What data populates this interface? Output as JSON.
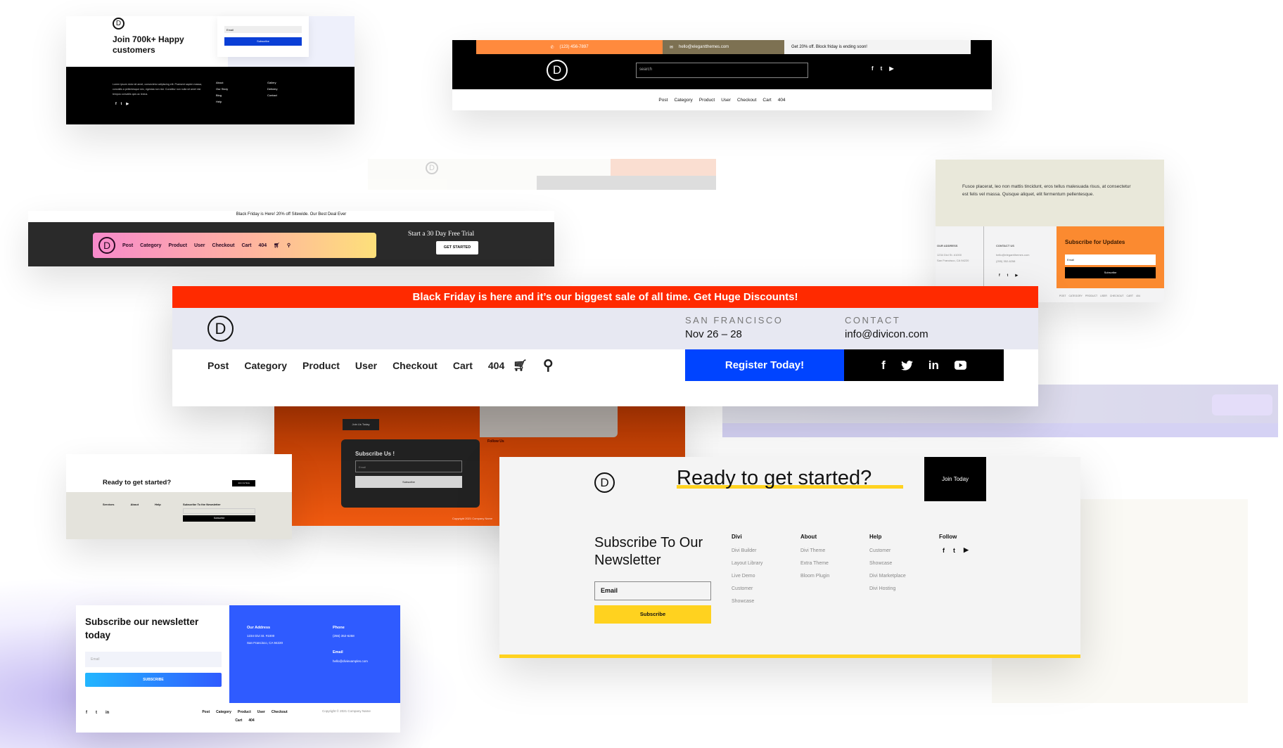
{
  "card_join": {
    "title": "Join 700k+ Happy customers",
    "email_placeholder": "Email",
    "subscribe": "Subscribe",
    "lorem": "Lorem ipsum dolor sit amet, consectetur adipiscing elit. Praesent sapien massa, convallis a pellentesque nec, egestas non nisi. Curabitur non nulla sit amet nisl tempus convallis quis ac lectus.",
    "col1": [
      "About",
      "Our Story",
      "Blog",
      "Help"
    ],
    "col2": [
      "Gallery",
      "Delivery",
      "Contact"
    ]
  },
  "card_search": {
    "phone": "(123) 456-7897",
    "email": "hello@elegantthemes.com",
    "promo": "Get 20% off. Block friday is ending soon!",
    "search_placeholder": "search",
    "nav": [
      "Post",
      "Category",
      "Product",
      "User",
      "Checkout",
      "Cart",
      "404"
    ]
  },
  "card_gradient": {
    "banner": "Black Friday is Here! 20% off Sitewide. Our Best Deal Ever",
    "nav": [
      "Post",
      "Category",
      "Product",
      "User",
      "Checkout",
      "Cart",
      "404"
    ],
    "trial": "Start a 30 Day Free Trial",
    "cta": "GET STARTED"
  },
  "card_fusce": {
    "quote": "Fusce placerat, leo non mattis tincidunt, eros tellus malesuada risus, at consectetur est felis vel massa. Quisque aliquet, elit fermentum pellentesque.",
    "address_label": "OUR ADDRESS",
    "address": [
      "1234 Divi St. #1000",
      "San Francisco, CA 94220"
    ],
    "contact_label": "CONTACT US",
    "contact": [
      "hello@elegantthemes.com",
      "(255) 352-6258"
    ],
    "subscribe_title": "Subscribe for Updates",
    "email_placeholder": "Email",
    "subscribe": "Subscribe",
    "nav": [
      "POST",
      "CATEGORY",
      "PRODUCT",
      "USER",
      "CHECKOUT",
      "CART",
      "404"
    ]
  },
  "main_header": {
    "banner": "Black Friday is here and it’s our biggest sale of all time. Get Huge Discounts!",
    "city_label": "SAN FRANCISCO",
    "dates": "Nov 26 – 28",
    "contact_label": "CONTACT",
    "contact_email": "info@divicon.com",
    "nav": [
      "Post",
      "Category",
      "Product",
      "User",
      "Checkout",
      "Cart",
      "404"
    ],
    "register": "Register Today!",
    "colors": {
      "banner": "#ff2a00",
      "register": "#0044ff",
      "band": "#e7e8f2"
    }
  },
  "card_orange": {
    "join": "Join Us Today",
    "subscribe_title": "Subscribe Us !",
    "email_placeholder": "Email",
    "subscribe": "Subscribe",
    "follow": "Follow Us",
    "copyright": "Copyright 2021 Company Name"
  },
  "card_ready_small": {
    "title": "Ready to get started?",
    "join": "Join Us Now",
    "cols": [
      "Services",
      "About",
      "Help"
    ],
    "newsletter": "Subscribe To the Newsletter",
    "subscribe": "Subscribe"
  },
  "card_footer": {
    "title": "Ready to get started?",
    "join": "Join Today",
    "newsletter_title": "Subscribe To Our Newsletter",
    "email_placeholder": "Email",
    "subscribe": "Subscribe",
    "columns": [
      {
        "heading": "Divi",
        "items": [
          "Divi Builder",
          "Layout Library",
          "Live Demo",
          "Customer",
          "Showcase"
        ]
      },
      {
        "heading": "About",
        "items": [
          "Divi Theme",
          "Extra Theme",
          "Bloom Plugin"
        ]
      },
      {
        "heading": "Help",
        "items": [
          "Customer",
          "Showcase",
          "Divi Marketplace",
          "Divi Hosting"
        ]
      }
    ],
    "follow": "Follow",
    "accent": "#ffd21f"
  },
  "card_blue": {
    "title": "Subscribe our newsletter today",
    "email_placeholder": "Email",
    "subscribe": "SUBSCRIBE",
    "address_label": "Our Address",
    "address": [
      "1234 Divi St. #1000",
      "San Francisco, CA 94220"
    ],
    "phone_label": "Phone",
    "phone": "(255) 352-6258",
    "email_label": "Email",
    "email": "hello@diviexamples.com",
    "nav": [
      "Post",
      "Category",
      "Product",
      "User",
      "Checkout",
      "Cart",
      "404"
    ],
    "copyright": "Copyright © 2021 Company Name",
    "accent": "#2f5bff"
  }
}
